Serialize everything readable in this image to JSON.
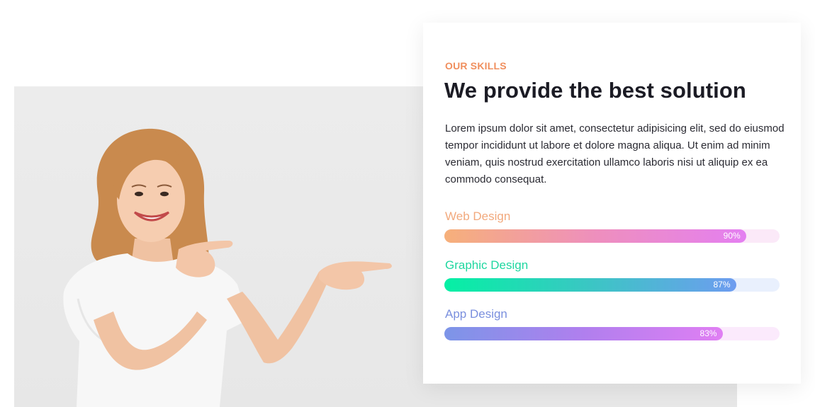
{
  "section": {
    "eyebrow": "OUR SKILLS",
    "heading": "We provide the best solution",
    "body": "Lorem ipsum dolor sit amet, consectetur adipisicing elit, sed do eiusmod tempor incididunt ut labore et dolore magna aliqua. Ut enim ad minim veniam, quis nostrud exercitation ullamco laboris nisi ut aliquip ex ea commodo consequat."
  },
  "colors": {
    "eyebrow": "#f08f5e",
    "web": "#f2a97d",
    "graphic": "#1fd7a0",
    "app": "#7a8fde"
  },
  "skills": [
    {
      "label": "Web Design",
      "percent_label": "90%",
      "value": 90,
      "label_color": "#f2a97d",
      "gradient": [
        "#f6b07a",
        "#ee8fbd",
        "#e47ff1"
      ],
      "track_color": "#fbe9f8"
    },
    {
      "label": "Graphic Design",
      "percent_label": "87%",
      "value": 87,
      "label_color": "#1fd7a0",
      "gradient": [
        "#05f0a4",
        "#3bc6c4",
        "#6e9cf0"
      ],
      "track_color": "#e9f0fd"
    },
    {
      "label": "App Design",
      "percent_label": "83%",
      "value": 83,
      "label_color": "#7a8fde",
      "gradient": [
        "#7c95e8",
        "#b07fee",
        "#e07ff3"
      ],
      "track_color": "#fbeafc"
    }
  ]
}
